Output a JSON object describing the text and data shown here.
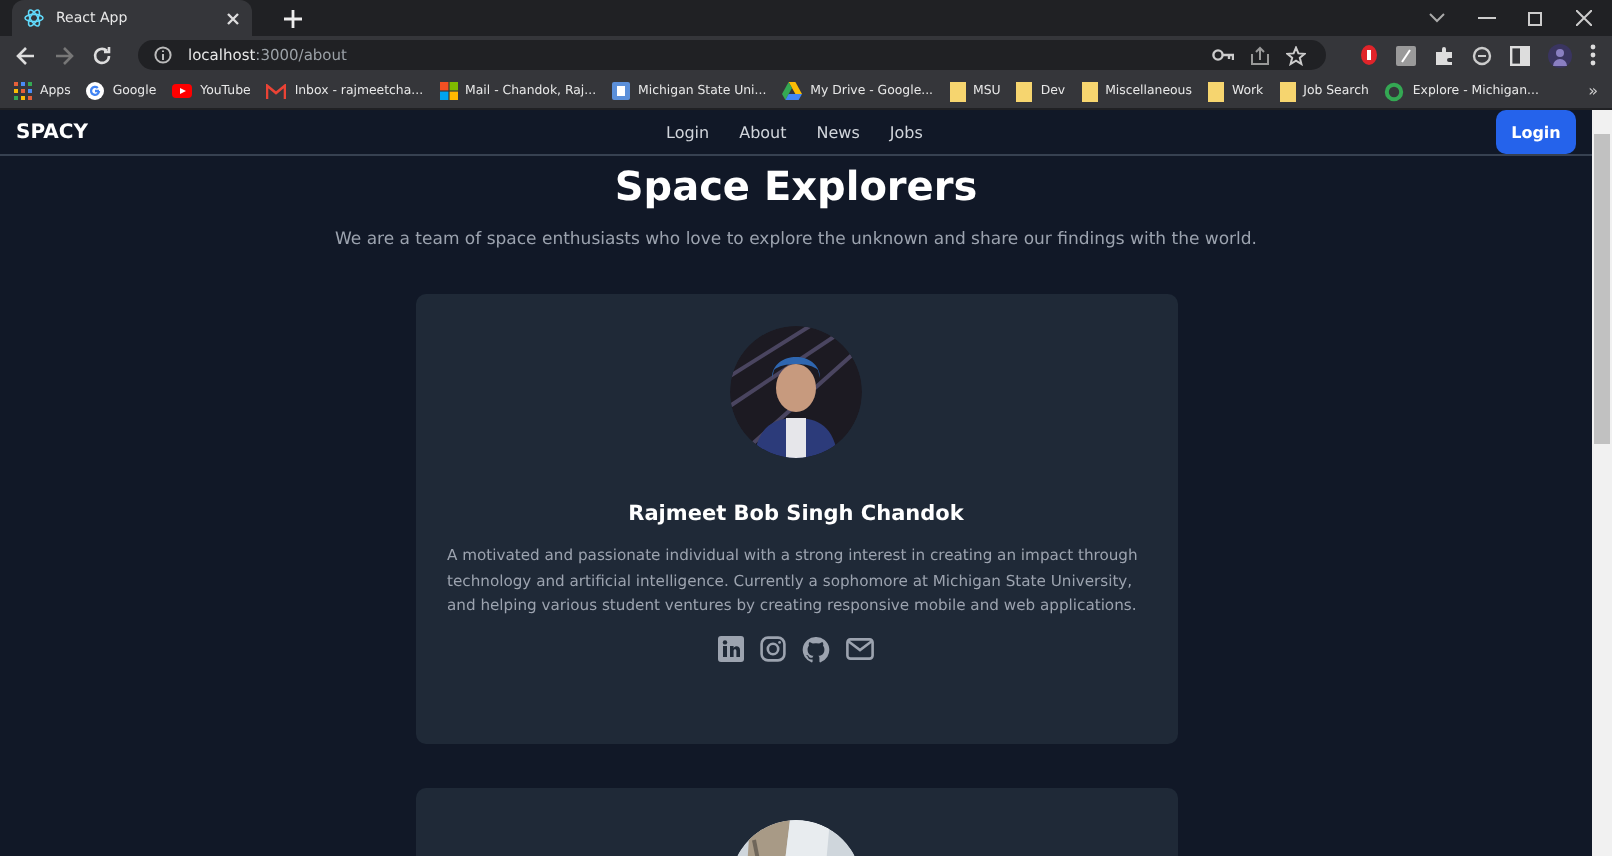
{
  "browser": {
    "tab_title": "React App",
    "url_host": "localhost",
    "url_path": ":3000/about",
    "bookmarks": [
      {
        "label": "Apps",
        "kind": "apps"
      },
      {
        "label": "Google",
        "kind": "google"
      },
      {
        "label": "YouTube",
        "kind": "youtube"
      },
      {
        "label": "Inbox - rajmeetcha...",
        "kind": "gmail"
      },
      {
        "label": "Mail - Chandok, Raj...",
        "kind": "ms"
      },
      {
        "label": "Michigan State Uni...",
        "kind": "msu"
      },
      {
        "label": "My Drive - Google...",
        "kind": "drive"
      },
      {
        "label": "MSU",
        "kind": "folder"
      },
      {
        "label": "Dev",
        "kind": "folder"
      },
      {
        "label": "Miscellaneous",
        "kind": "folder"
      },
      {
        "label": "Work",
        "kind": "folder"
      },
      {
        "label": "Job Search",
        "kind": "folder"
      },
      {
        "label": "Explore - Michigan...",
        "kind": "explore"
      }
    ],
    "more": "»"
  },
  "navbar": {
    "brand": "SPACY",
    "links": [
      "Login",
      "About",
      "News",
      "Jobs"
    ],
    "button": "Login"
  },
  "hero": {
    "title": "Space Explorers",
    "subtitle": "We are a team of space enthusiasts who love to explore the unknown and share our findings with the world."
  },
  "members": [
    {
      "name": "Rajmeet Bob Singh Chandok",
      "bio": "A motivated and passionate individual with a strong interest in creating an impact through technology and artificial intelligence. Currently a sophomore at Michigan State University, and helping various student ventures by creating responsive mobile and web applications.",
      "socials": [
        {
          "kind": "linkedin"
        },
        {
          "kind": "instagram"
        },
        {
          "kind": "github"
        },
        {
          "kind": "mail"
        }
      ],
      "photo": {
        "kind": "picture"
      }
    },
    {
      "photo": {
        "kind": "picture"
      }
    }
  ]
}
